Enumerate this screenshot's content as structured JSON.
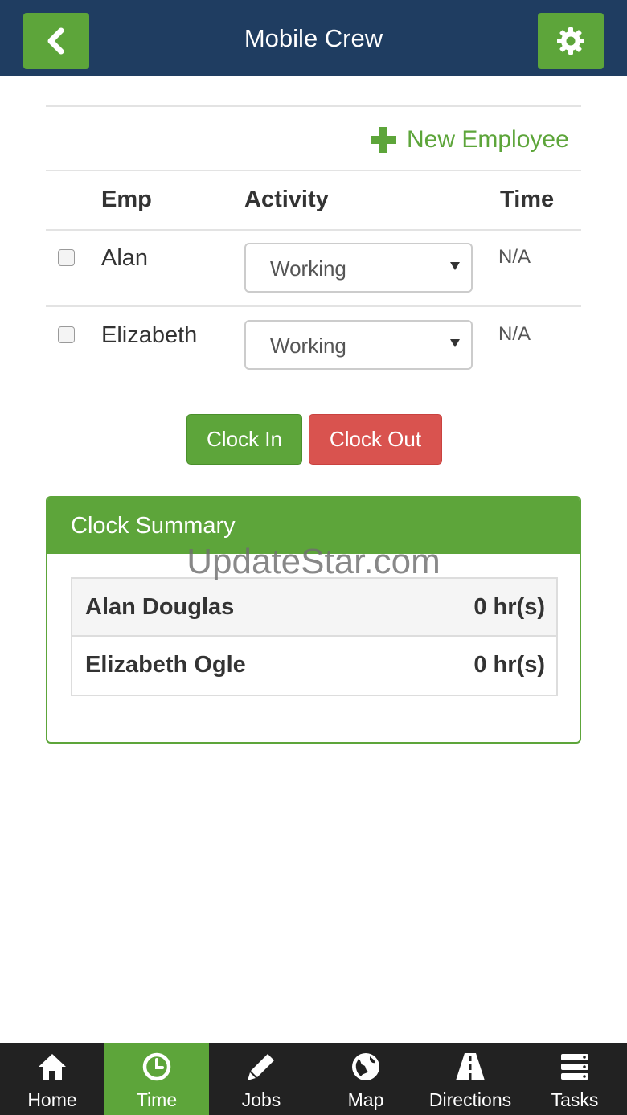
{
  "header": {
    "title": "Mobile Crew",
    "back_icon": "chevron-left-icon",
    "settings_icon": "gear-icon"
  },
  "toolbar": {
    "new_employee_label": "New Employee",
    "new_employee_icon": "plus-icon"
  },
  "table": {
    "headers": {
      "emp": "Emp",
      "activity": "Activity",
      "time": "Time"
    },
    "rows": [
      {
        "name": "Alan",
        "activity": "Working",
        "time": "N/A",
        "checked": false
      },
      {
        "name": "Elizabeth",
        "activity": "Working",
        "time": "N/A",
        "checked": false
      }
    ]
  },
  "actions": {
    "clock_in": "Clock In",
    "clock_out": "Clock Out"
  },
  "summary": {
    "title": "Clock Summary",
    "rows": [
      {
        "name": "Alan Douglas",
        "hours": "0 hr(s)"
      },
      {
        "name": "Elizabeth Ogle",
        "hours": "0 hr(s)"
      }
    ]
  },
  "watermark": "UpdateStar.com",
  "nav": {
    "items": [
      {
        "label": "Home",
        "icon": "home-icon"
      },
      {
        "label": "Time",
        "icon": "clock-icon",
        "active": true
      },
      {
        "label": "Jobs",
        "icon": "pencil-icon"
      },
      {
        "label": "Map",
        "icon": "globe-icon"
      },
      {
        "label": "Directions",
        "icon": "road-icon"
      },
      {
        "label": "Tasks",
        "icon": "list-icon"
      }
    ]
  },
  "colors": {
    "header_bg": "#1f3d61",
    "accent_green": "#5da53a",
    "danger_red": "#d9534f",
    "nav_bg": "#222222"
  }
}
